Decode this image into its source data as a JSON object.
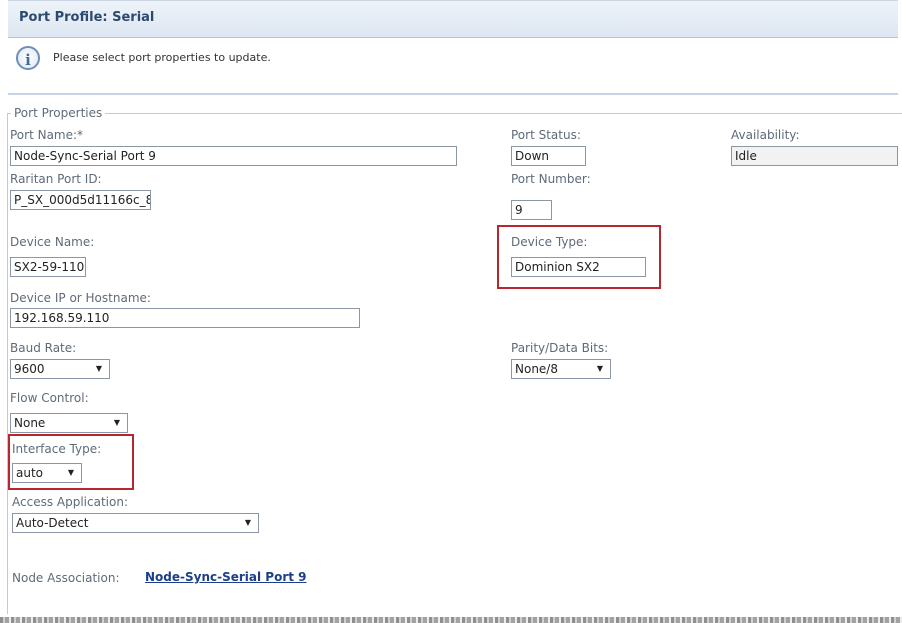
{
  "header": {
    "title": "Port Profile: Serial"
  },
  "info": {
    "message": "Please select port properties to update.",
    "icon": "info-icon"
  },
  "properties": {
    "legend": "Port Properties",
    "port_name": {
      "label": "Port Name:*",
      "value": "Node-Sync-Serial Port 9"
    },
    "port_status": {
      "label": "Port Status:",
      "value": "Down"
    },
    "availability": {
      "label": "Availability:",
      "value": "Idle"
    },
    "raritan_port_id": {
      "label": "Raritan Port ID:",
      "value": "P_SX_000d5d11166c_8"
    },
    "port_number": {
      "label": "Port Number:",
      "value": "9"
    },
    "device_name": {
      "label": "Device Name:",
      "value": "SX2-59-110"
    },
    "device_type": {
      "label": "Device Type:",
      "value": "Dominion SX2"
    },
    "device_ip": {
      "label": "Device IP or Hostname:",
      "value": "192.168.59.110"
    },
    "baud_rate": {
      "label": "Baud Rate:",
      "value": "9600"
    },
    "parity": {
      "label": "Parity/Data Bits:",
      "value": "None/8"
    },
    "flow_control": {
      "label": "Flow Control:",
      "value": "None"
    },
    "interface_type": {
      "label": "Interface Type:",
      "value": "auto"
    },
    "access_application": {
      "label": "Access Application:",
      "value": "Auto-Detect"
    },
    "node_association": {
      "label": "Node Association:",
      "link": "Node-Sync-Serial Port 9"
    }
  },
  "colors": {
    "highlight": "#b8262f",
    "header_text": "#2b4a6f",
    "link": "#1b3f8a"
  }
}
